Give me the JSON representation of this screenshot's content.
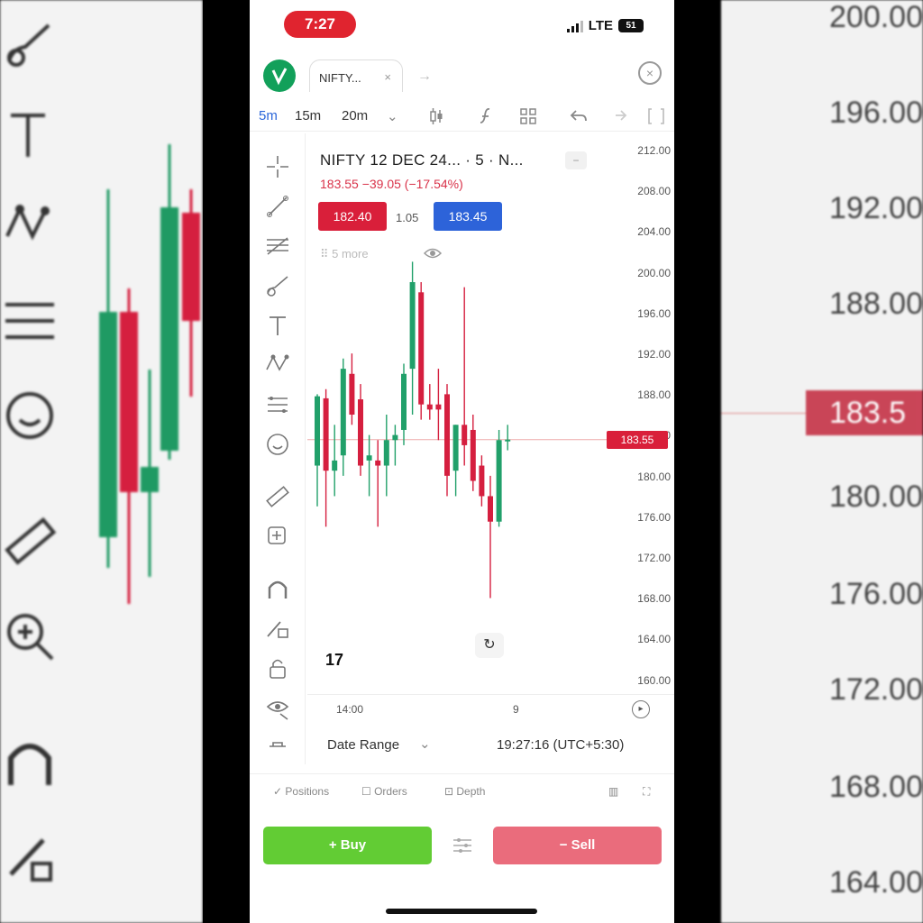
{
  "status_bar": {
    "time": "7:27",
    "network": "LTE",
    "battery": "51"
  },
  "tabs": {
    "active_tab": "NIFTY...",
    "active_tab_close": "×",
    "new_tab": "→",
    "close": "×"
  },
  "toolbar": {
    "timeframes": [
      "5m",
      "15m",
      "20m"
    ],
    "active_timeframe": "5m",
    "timeframe_dropdown": "⌄"
  },
  "symbol": {
    "title": "NIFTY 12 DEC 24...  · 5 · N...",
    "last_change": "183.55  −39.05 (−17.54%)",
    "bid": "182.40",
    "spread": "1.05",
    "ask": "183.45",
    "volume_label": "⠿  5 more"
  },
  "price_axis": [
    "212.00",
    "208.00",
    "204.00",
    "200.00",
    "196.00",
    "192.00",
    "188.00",
    "184.00",
    "180.00",
    "176.00",
    "172.00",
    "168.00",
    "164.00",
    "160.00"
  ],
  "last_price_tag": "183.55",
  "time_axis": {
    "left": "14:00",
    "right": "9"
  },
  "watermark": "17",
  "date_row": {
    "label": "Date Range",
    "chevron": "⌄",
    "clock": "19:27:16 (UTC+5:30)"
  },
  "bottom_tabs": {
    "positions": "Positions",
    "orders": "Orders",
    "depth": "Depth"
  },
  "trade": {
    "buy": "+  Buy",
    "sell": "−  Sell"
  },
  "background_zoom": {
    "price_labels": [
      "200.00",
      "196.00",
      "192.00",
      "188.00",
      "180.00",
      "176.00",
      "172.00",
      "168.00",
      "164.00"
    ],
    "price_tag": "183.5"
  },
  "colors": {
    "up": "#21a06a",
    "down": "#d51f3f",
    "buy": "#62cc34",
    "sell": "#ea6c7c",
    "accent": "#2b66d9"
  },
  "chart_data": {
    "type": "candlestick",
    "title": "NIFTY 12 DEC 24...",
    "ylim": [
      160,
      212
    ],
    "candles": [
      {
        "o": 181.0,
        "h": 188.0,
        "l": 177.0,
        "c": 187.8
      },
      {
        "o": 187.6,
        "h": 188.5,
        "l": 175.0,
        "c": 180.5
      },
      {
        "o": 180.5,
        "h": 185.0,
        "l": 178.0,
        "c": 181.5
      },
      {
        "o": 182.0,
        "h": 191.5,
        "l": 180.0,
        "c": 190.5
      },
      {
        "o": 190.0,
        "h": 192.0,
        "l": 185.0,
        "c": 186.0
      },
      {
        "o": 187.5,
        "h": 189.0,
        "l": 180.0,
        "c": 181.0
      },
      {
        "o": 181.5,
        "h": 184.0,
        "l": 178.0,
        "c": 182.0
      },
      {
        "o": 181.5,
        "h": 183.5,
        "l": 175.0,
        "c": 181.0
      },
      {
        "o": 181.0,
        "h": 186.0,
        "l": 178.0,
        "c": 183.5
      },
      {
        "o": 183.5,
        "h": 185.0,
        "l": 181.0,
        "c": 184.0
      },
      {
        "o": 184.5,
        "h": 191.0,
        "l": 183.0,
        "c": 190.0
      },
      {
        "o": 190.5,
        "h": 201.0,
        "l": 186.0,
        "c": 199.0
      },
      {
        "o": 198.0,
        "h": 199.0,
        "l": 185.5,
        "c": 187.0
      },
      {
        "o": 187.0,
        "h": 189.0,
        "l": 185.5,
        "c": 186.5
      },
      {
        "o": 187.0,
        "h": 190.5,
        "l": 183.5,
        "c": 186.5
      },
      {
        "o": 188.0,
        "h": 189.0,
        "l": 178.0,
        "c": 180.0
      },
      {
        "o": 180.5,
        "h": 185.0,
        "l": 178.0,
        "c": 185.0
      },
      {
        "o": 185.0,
        "h": 198.5,
        "l": 181.0,
        "c": 183.0
      },
      {
        "o": 184.5,
        "h": 186.0,
        "l": 178.5,
        "c": 179.5
      },
      {
        "o": 181.0,
        "h": 182.0,
        "l": 177.0,
        "c": 178.0
      },
      {
        "o": 178.0,
        "h": 180.0,
        "l": 168.0,
        "c": 175.5
      },
      {
        "o": 175.5,
        "h": 184.5,
        "l": 175.0,
        "c": 183.5
      },
      {
        "o": 183.5,
        "h": 185.0,
        "l": 182.5,
        "c": 183.55
      }
    ]
  }
}
